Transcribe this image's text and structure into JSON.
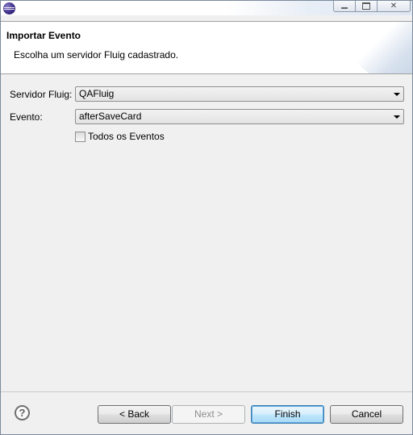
{
  "window": {
    "app_icon": "eclipse-icon",
    "buttons": [
      "minimize-icon",
      "maximize-icon",
      "close-icon"
    ],
    "close_glyph": "✕"
  },
  "header": {
    "title": "Importar Evento",
    "message": "Escolha um servidor Fluig cadastrado."
  },
  "form": {
    "server_label": "Servidor Fluig:",
    "server_value": "QAFluig",
    "event_label": "Evento:",
    "event_value": "afterSaveCard",
    "all_events_label": "Todos os Eventos",
    "all_events_checked": false
  },
  "footer": {
    "help_glyph": "?",
    "back_label": "< Back",
    "next_label": "Next >",
    "finish_label": "Finish",
    "cancel_label": "Cancel"
  }
}
